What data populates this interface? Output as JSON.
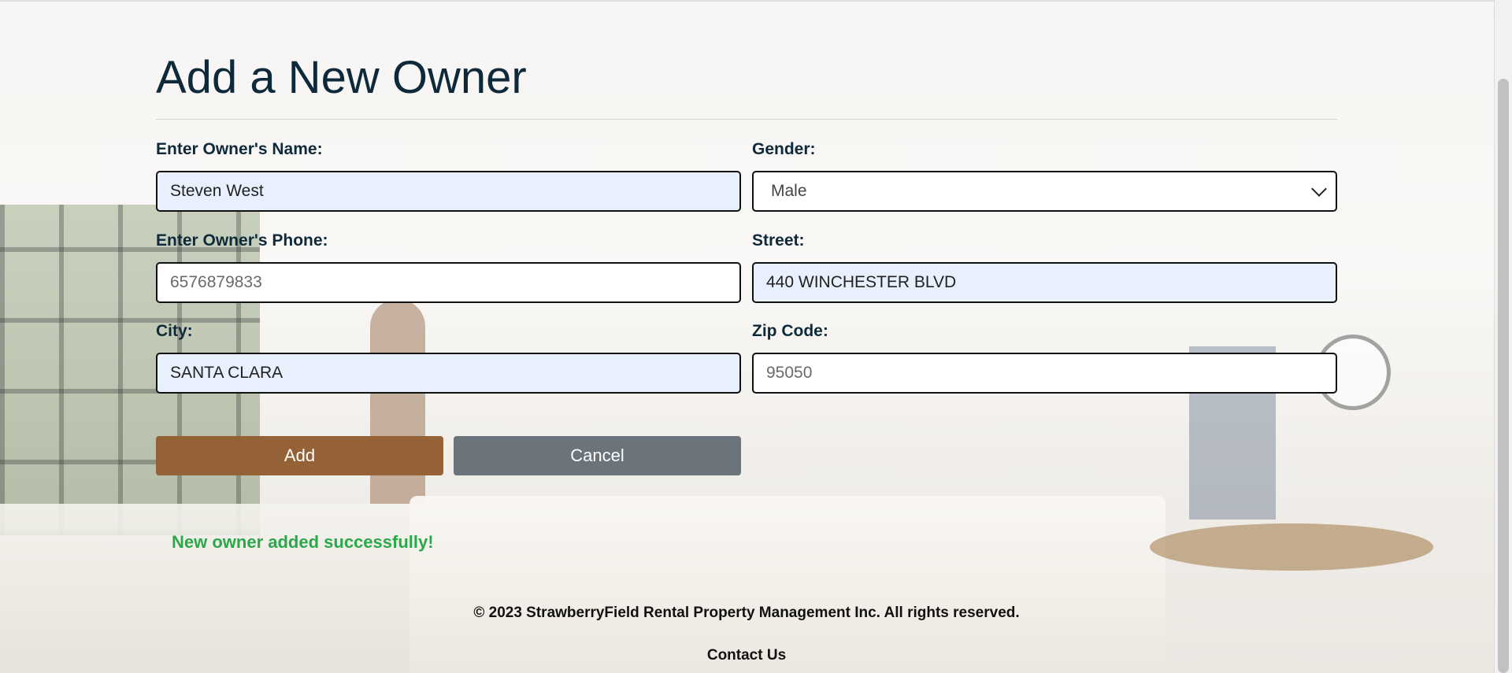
{
  "page": {
    "title": "Add a New Owner"
  },
  "form": {
    "name": {
      "label": "Enter Owner's Name:",
      "value": "Steven West"
    },
    "gender": {
      "label": "Gender:",
      "selected": "Male"
    },
    "phone": {
      "label": "Enter Owner's Phone:",
      "placeholder": "6576879833"
    },
    "street": {
      "label": "Street:",
      "value": "440 WINCHESTER BLVD"
    },
    "city": {
      "label": "City:",
      "value": "SANTA CLARA"
    },
    "zip": {
      "label": "Zip Code:",
      "placeholder": "95050"
    }
  },
  "buttons": {
    "add_label": "Add",
    "cancel_label": "Cancel"
  },
  "status": {
    "message": "New owner added successfully!",
    "color": "#2aa84a"
  },
  "footer": {
    "copyright": "© 2023 StrawberryField Rental Property Management Inc. All rights reserved.",
    "contact_label": "Contact Us"
  },
  "colors": {
    "add_button": "#946236",
    "cancel_button": "#6b737b",
    "heading": "#0e2a3a"
  }
}
